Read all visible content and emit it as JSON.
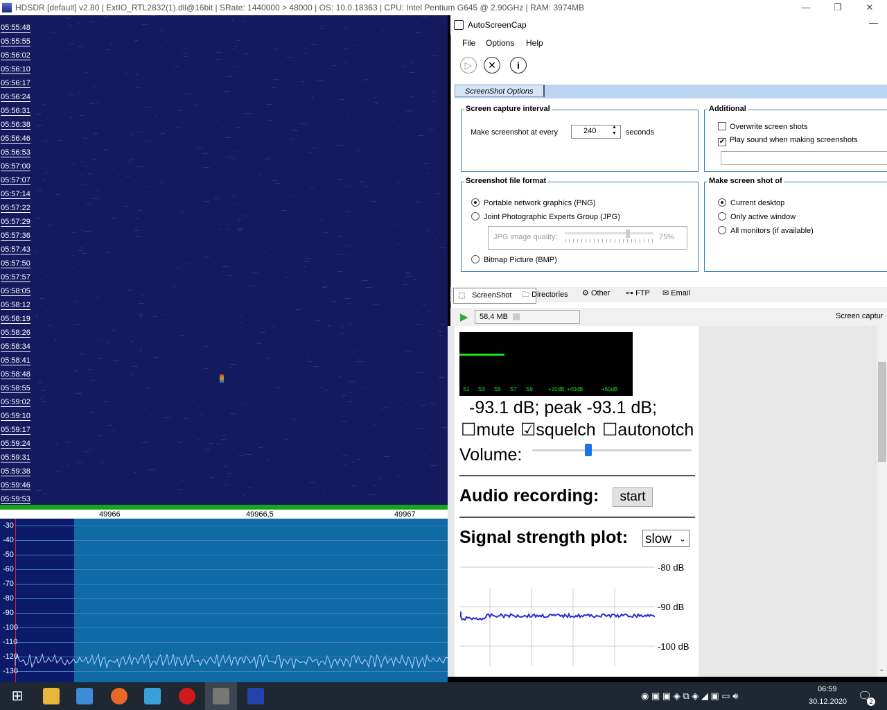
{
  "hdsdr": {
    "title": "HDSDR  [default]  v2.80   |  ExtIO_RTL2832(1).dll@16bit  |  SRate: 1440000 > 48000  |  OS: 10.0.18363  |  CPU: Intel Pentium G645 @ 2.90GHz  |  RAM: 3974MB",
    "times": [
      "05:55:48",
      "05:55:55",
      "05:56:02",
      "05:56:10",
      "05:56:17",
      "05:56:24",
      "05:56:31",
      "05:56:38",
      "05:56:46",
      "05:56:53",
      "05:57:00",
      "05:57:07",
      "05:57:14",
      "05:57:22",
      "05:57:29",
      "05:57:36",
      "05:57:43",
      "05:57:50",
      "05:57:57",
      "05:58:05",
      "05:58:12",
      "05:58:19",
      "05:58:26",
      "05:58:34",
      "05:58:41",
      "05:58:48",
      "05:58:55",
      "05:59:02",
      "05:59:10",
      "05:59:17",
      "05:59:24",
      "05:59:31",
      "05:59:38",
      "05:59:46",
      "05:59:53"
    ],
    "freq_labels": [
      "49966",
      "49966,5",
      "49967"
    ],
    "db_labels": [
      "-30",
      "-40",
      "-50",
      "-60",
      "-70",
      "-80",
      "-90",
      "-100",
      "-110",
      "-120",
      "-130"
    ],
    "colors": {
      "waterfall": "#141a5e",
      "spectrum_passband": "#0f6aa6",
      "marker": "#e02020"
    }
  },
  "browser": {
    "level_text": "-93.1 dB; peak   -93.1 dB;",
    "mute_label": "mute",
    "squelch_label": "squelch",
    "autonotch_label": "autonotch",
    "mute_checked": false,
    "squelch_checked": true,
    "autonotch_checked": false,
    "volume_label": "Volume:",
    "volume_level": 0.35,
    "audio_recording_label": "Audio recording:",
    "start_button": "start",
    "signal_plot_label": "Signal strength plot:",
    "plot_speed": "slow",
    "smeter_scale": [
      "S1",
      "S3",
      "S5",
      "S7",
      "S9",
      "+20dB",
      "+40dB",
      "+60dB"
    ],
    "plot_db_labels": [
      "-80 dB",
      "-90 dB",
      "-100 dB"
    ]
  },
  "asc": {
    "title": "AutoScreenCap",
    "menu": [
      "File",
      "Options",
      "Help"
    ],
    "options_tab": "ScreenShot Options",
    "capture_group": "Screen capture interval",
    "make_every": "Make screenshot at every",
    "interval": "240",
    "seconds": "seconds",
    "additional_group": "Additional",
    "overwrite": "Overwrite screen shots",
    "overwrite_checked": false,
    "play_sound": "Play sound when making screenshots",
    "play_sound_checked": true,
    "format_group": "Screenshot file format",
    "formats": [
      "Portable network graphics (PNG)",
      "Joint Photographic Experts Group (JPG)",
      "Bitmap Picture (BMP)"
    ],
    "selected_format": 0,
    "jpg_quality_label": "JPG image quality:",
    "jpg_quality_value": "75%",
    "target_group": "Make screen shot of",
    "targets": [
      "Current desktop",
      "Only active window",
      "All monitors (if available)"
    ],
    "selected_target": 0,
    "tabs": [
      "ScreenShot",
      "Directories",
      "Other",
      "FTP",
      "Email"
    ],
    "size": "58,4 MB",
    "status": "Screen captur"
  },
  "taskbar": {
    "time": "06:59",
    "date": "30.12.2020",
    "notif_count": "2"
  }
}
